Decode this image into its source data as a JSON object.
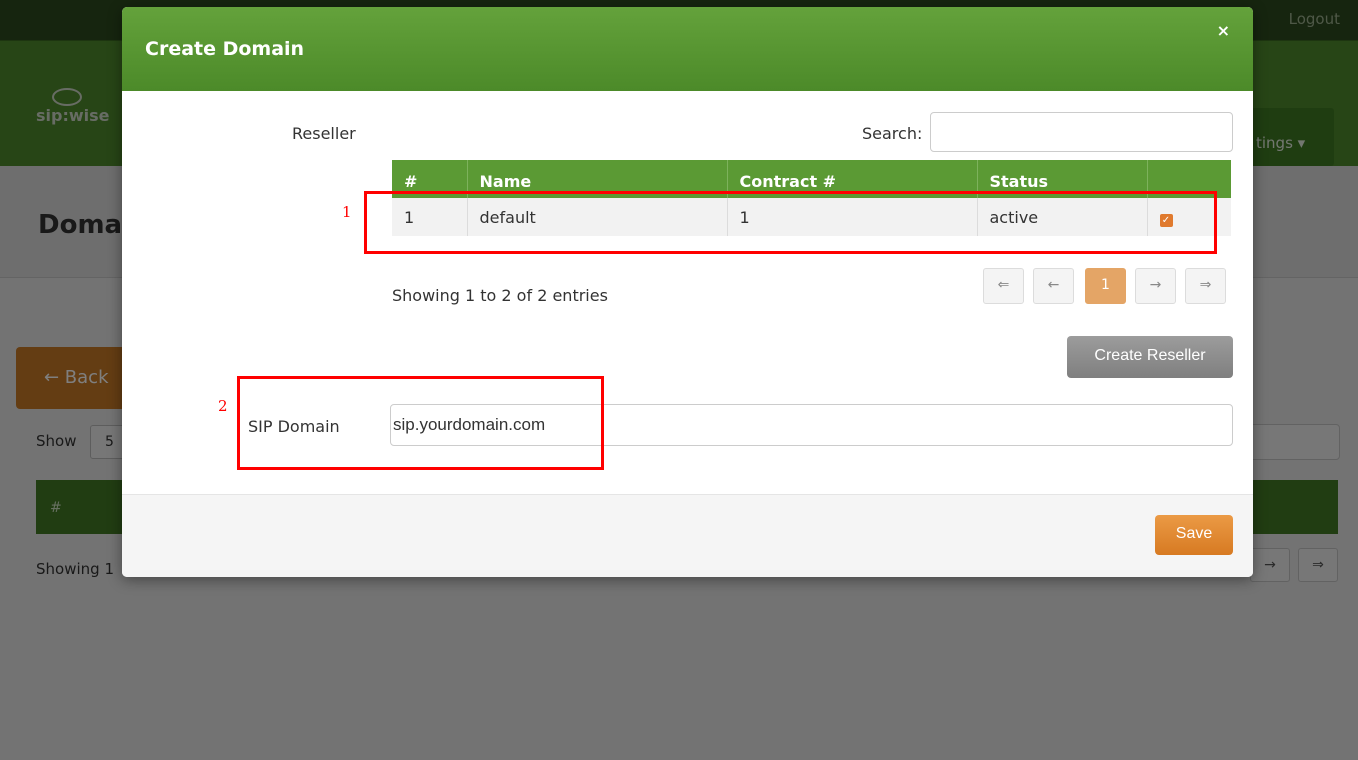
{
  "topbar": {
    "logout_label": "Logout"
  },
  "navbar": {
    "logo_text": "sip:wise",
    "settings_label": "tings ▾"
  },
  "page": {
    "title": "Doma",
    "back_label": "← Back"
  },
  "bg_list": {
    "show_label": "Show",
    "show_value": "5",
    "table_header_first": "#",
    "showing_text": "Showing 1",
    "pager_next": "→",
    "pager_last": "⇒"
  },
  "modal": {
    "title": "Create Domain",
    "close_label": "×",
    "reseller_label": "Reseller",
    "search_label": "Search:",
    "search_value": "",
    "table": {
      "headers": [
        "#",
        "Name",
        "Contract #",
        "Status",
        ""
      ],
      "rows": [
        {
          "id": "1",
          "name": "default",
          "contract": "1",
          "status": "active",
          "selected": true
        }
      ]
    },
    "showing_text": "Showing 1 to 2 of 2 entries",
    "pagination": {
      "first": "⇐",
      "prev": "←",
      "current": "1",
      "next": "→",
      "last": "⇒"
    },
    "create_reseller_label": "Create Reseller",
    "sip_domain_label": "SIP Domain",
    "sip_domain_value": "sip.yourdomain.com",
    "save_label": "Save"
  },
  "annotations": {
    "mark1": "1",
    "mark2": "2",
    "color": "#ff0000"
  },
  "colors": {
    "header_green": "#5b9a34",
    "accent_orange": "#d77a22"
  }
}
